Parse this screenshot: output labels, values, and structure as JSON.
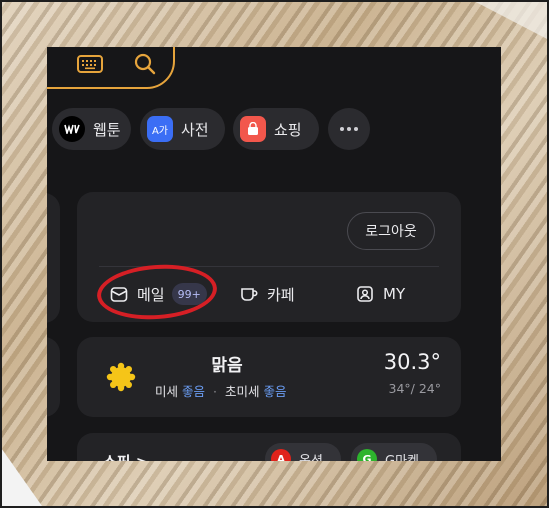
{
  "chips": [
    {
      "label": "웹툰",
      "icon": "webtoon-icon",
      "color": "#000000"
    },
    {
      "label": "사전",
      "icon": "dictionary-icon",
      "color": "#3b6ef5",
      "glyph": "A가"
    },
    {
      "label": "쇼핑",
      "icon": "shopping-bag-icon",
      "color": "#f2574c"
    },
    {
      "label": "",
      "icon": "more-icon"
    }
  ],
  "login": {
    "logout_label": "로그아웃",
    "mail_label": "메일",
    "mail_badge": "99+",
    "cafe_label": "카페",
    "my_label": "MY"
  },
  "weather": {
    "condition": "맑음",
    "fine_dust_label": "미세",
    "fine_dust_value": "좋음",
    "ultra_dust_label": "초미세",
    "ultra_dust_value": "좋음",
    "temperature": "30.3°",
    "range": "34°/ 24°"
  },
  "shopping": {
    "title": "쇼핑 >",
    "auction_label": "옥션",
    "auction_badge": "A",
    "gmarket_label": "G마켓",
    "gmarket_badge": "G"
  },
  "colors": {
    "accent_search": "#e6a43c",
    "annotation": "#d61f25",
    "good_status": "#6a9cf2",
    "auction": "#e0231b",
    "gmarket": "#2db42d"
  }
}
